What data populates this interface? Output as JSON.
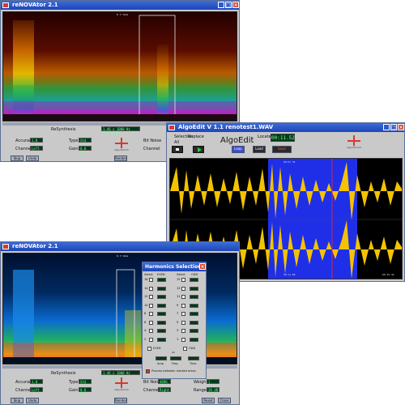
{
  "colors": {
    "title_bar": "#2a56c6",
    "panel_bg": "#c9c9c9",
    "waveform": "#f5c200",
    "selection": "#1f2fe8",
    "spectrogram_low": "#1a0000",
    "close_button": "#d8452c"
  },
  "window1": {
    "title": "reNOVAtor 2.1",
    "spec_label": "N 3'16ms",
    "panel_title": "ReSynthesis",
    "readout": "1.46 s  1000 Hz  156.0 dB",
    "accuracy_label": "Accuracy",
    "accuracy_value": "1.0",
    "type_label": "Type",
    "type_value": "Std",
    "channel_label": "Channel",
    "channel_value": "Left",
    "gain_label": "Gain",
    "gain_value": "0.0 dB",
    "logo_text": "AlgorithmiX",
    "bitnoise_label": "Bit Noise",
    "channel2_label": "Channel",
    "btn_a": "Skip",
    "btn_b": "Undo",
    "btn_render": "Render"
  },
  "window2": {
    "title": "AlgoEdit V 1.1   renotest1.WAV",
    "radio_1": "Selection",
    "radio_2": "Replace",
    "radio_3": "All",
    "app_name": "AlgoEdit",
    "time_label": "Locate",
    "time_value": "00:11.52",
    "btn_loop": "Loop",
    "btn_load": "Load",
    "btn_save": "Save",
    "logo_text": "AlgorithmiX",
    "wave_marker_top": "00:07.35",
    "wave_marker_bottom": "00:11.08",
    "wave_start_time": "00:00.00",
    "wave_end_time": "00:19.49"
  },
  "window3": {
    "title": "reNOVAtor 2.1",
    "spec_label": "N 3'16ms",
    "panel_title": "ReSynthesis",
    "readout": "1.46 s  1000 Hz  156.0 dB",
    "accuracy_label": "Accuracy",
    "accuracy_value": "1.0",
    "type_label": "Type",
    "type_value": "Std",
    "channel_label": "Channel",
    "channel_value": "Left",
    "gain_label": "Gain",
    "gain_value": "0.0 dB",
    "logo_text": "AlgorithmiX",
    "bitnoise_label": "Bit Noise",
    "bitnoise_value": "4096",
    "channel2_label": "Channel",
    "channel2_value": "Right",
    "weight_label": "Weight",
    "weight_value": "1",
    "range_label": "Range",
    "range_value": "20 dB",
    "btn_a": "Skip",
    "btn_b": "Undo",
    "btn_render": "Render",
    "btn_reset": "Reset",
    "btn_close": "Close"
  },
  "harmonics": {
    "title": "Harmonics Selection",
    "col_select_even": "Select",
    "col_even": "EVEN",
    "col_select_odd": "Select",
    "col_odd": "ODD",
    "even_numbers": [
      "16",
      "14",
      "12",
      "10",
      "8",
      "6",
      "4",
      "2"
    ],
    "odd_numbers": [
      "15",
      "13",
      "11",
      "9",
      "7",
      "5",
      "3",
      "1"
    ],
    "footer_even": "EVEN",
    "footer_odd": "ODD",
    "footer_all": "All",
    "amp_label": "Amp",
    "freq_label": "Freq",
    "time_label": "Time",
    "process_label": "Process between marked areas"
  }
}
